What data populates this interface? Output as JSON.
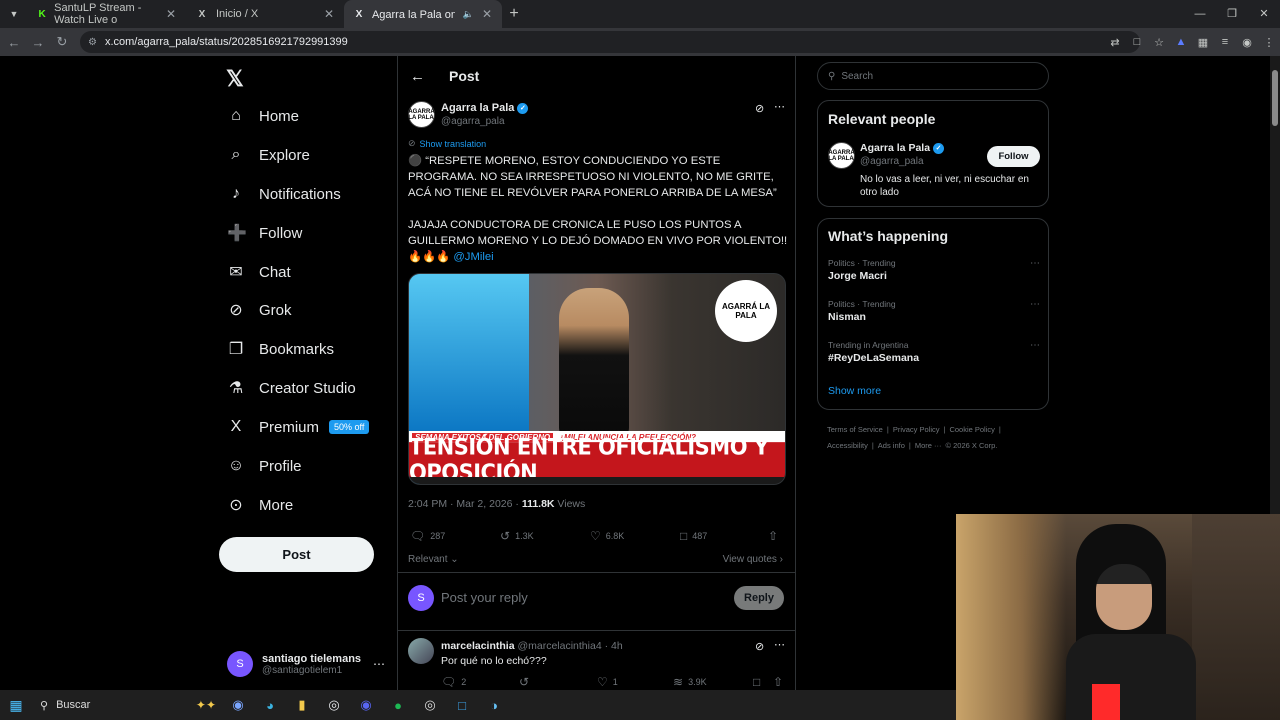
{
  "browser": {
    "tabs": [
      {
        "title": "SantuLP Stream - Watch Live o",
        "favicon": "K",
        "favicon_color": "#53fc18"
      },
      {
        "title": "Inicio / X",
        "favicon": "X",
        "favicon_color": "#e8eaed"
      },
      {
        "title": "Agarra la Pala on X: \"⚫ \"R",
        "favicon": "X",
        "favicon_color": "#e8eaed",
        "active": true
      }
    ],
    "url": "x.com/agarra_pala/status/2028516921792991399",
    "window_buttons": [
      "—",
      "❐",
      "✕"
    ]
  },
  "leftnav": {
    "items": [
      {
        "label": "Home",
        "icon": "⌂"
      },
      {
        "label": "Explore",
        "icon": "⌕"
      },
      {
        "label": "Notifications",
        "icon": "♪"
      },
      {
        "label": "Follow",
        "icon": "➕"
      },
      {
        "label": "Chat",
        "icon": "✉"
      },
      {
        "label": "Grok",
        "icon": "⊘"
      },
      {
        "label": "Bookmarks",
        "icon": "❐"
      },
      {
        "label": "Creator Studio",
        "icon": "⚗"
      },
      {
        "label": "Premium",
        "icon": "X"
      },
      {
        "label": "Profile",
        "icon": "☺"
      },
      {
        "label": "More",
        "icon": "⊙"
      }
    ],
    "premium_badge": "50% off",
    "post_button": "Post",
    "account": {
      "name": "santiago tielemans",
      "handle": "@santiagotielem1",
      "initial": "S"
    }
  },
  "main": {
    "header_title": "Post",
    "author": {
      "name": "Agarra la Pala",
      "handle": "@agarra_pala",
      "avatar_text": "AGARRÁ LA PALA"
    },
    "show_translation": "Show translation",
    "post_text_lines": [
      "⚫ “RESPETE MORENO, ESTOY CONDUCIENDO YO ESTE PROGRAMA. NO SEA IRRESPETUOSO NI VIOLENTO, NO ME GRITE, ACÁ NO TIENE EL REVÓLVER PARA PONERLO ARRIBA DE LA MESA”",
      "",
      "JAJAJA CONDUCTORA DE CRONICA LE PUSO LOS PUNTOS A GUILLERMO MORENO Y LO DEJÓ DOMADO EN VIVO POR VIOLENTO!! 🔥🔥🔥 "
    ],
    "mention": "@JMilei",
    "media": {
      "strip_red": "SEMANA EXITOSA DEL GOBIERNO",
      "strip_white": "¿MILEI ANUNCIA LA REELECCIÓN?",
      "headline": "TENSIÓN ENTRE OFICIALISMO Y OPOSICIÓN",
      "badge": "AGARRÁ LA PALA"
    },
    "meta": {
      "time": "2:04 PM · Mar 2, 2026 · ",
      "views_count": "111.8K",
      "views_label": " Views"
    },
    "actions": {
      "replies": "287",
      "reposts": "1.3K",
      "likes": "6.8K",
      "bookmarks": "487"
    },
    "relevant": "Relevant ⌄",
    "view_quotes": "View quotes ›",
    "reply_placeholder": "Post your reply",
    "reply_button": "Reply",
    "reply_avatar": "S",
    "comment": {
      "name": "marcelacinthia",
      "handle": "@marcelacinthia4 · 4h",
      "text": "Por qué no lo echó???",
      "replies": "2",
      "likes": "1",
      "views": "3.9K"
    }
  },
  "right": {
    "search_placeholder": "Search",
    "relevant_people": {
      "title": "Relevant people",
      "name": "Agarra la Pala",
      "handle": "@agarra_pala",
      "follow": "Follow",
      "bio": "No lo vas a leer, ni ver, ni escuchar en otro lado"
    },
    "whats_happening": {
      "title": "What’s happening",
      "trends": [
        {
          "context": "Politics · Trending",
          "topic": "Jorge Macri"
        },
        {
          "context": "Politics · Trending",
          "topic": "Nisman"
        },
        {
          "context": "Trending in Argentina",
          "topic": "#ReyDeLaSemana"
        }
      ],
      "show_more": "Show more"
    },
    "footer": [
      "Terms of Service",
      "|",
      "Privacy Policy",
      "|",
      "Cookie Policy",
      "|",
      "Accessibility",
      "|",
      "Ads info",
      "|",
      "More ···",
      "© 2026 X Corp."
    ]
  },
  "taskbar": {
    "search": "Buscar"
  }
}
